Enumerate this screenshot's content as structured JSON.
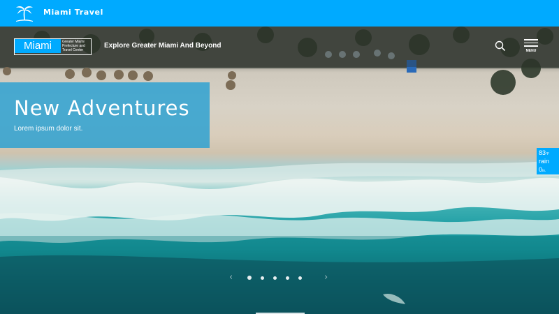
{
  "topbar": {
    "brand": "Miami Travel",
    "icon": "palm-tree-icon",
    "color": "#00aaff"
  },
  "header": {
    "logo_main": "Miami",
    "logo_sub": [
      "Greater Miami",
      "Prefecture and",
      "Travel Center"
    ],
    "tagline": "Explore Greater Miami And Beyond",
    "search_icon": "search-icon",
    "menu_label": "MENU"
  },
  "feature": {
    "title": "New Adventures",
    "subtitle": "Lorem ipsum dolor sit."
  },
  "weather": {
    "temp": "83",
    "temp_unit": "°F",
    "condition": "rain",
    "amount": "0",
    "amount_unit": "in."
  },
  "slider": {
    "dot_count": 5,
    "active_index": 0,
    "prev_arrow": "‹",
    "next_arrow": "›"
  }
}
